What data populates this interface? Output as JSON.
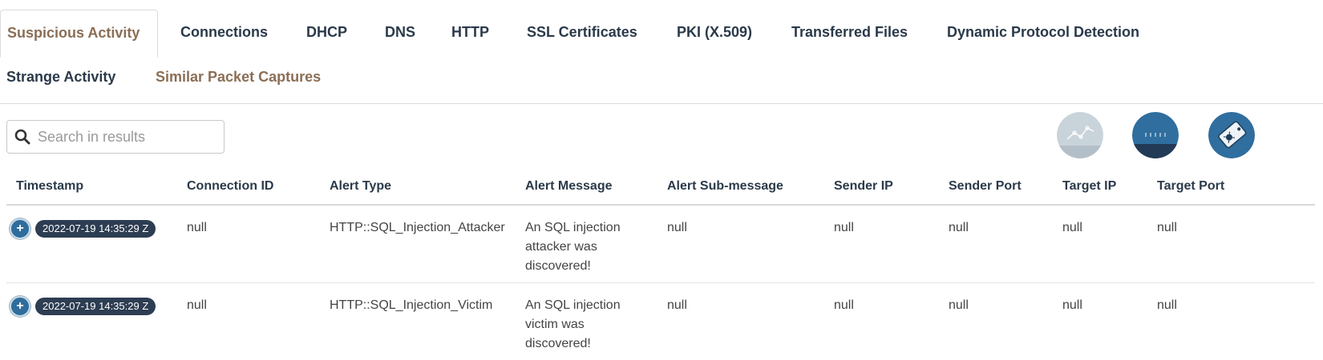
{
  "tabs": [
    {
      "label": "Suspicious Activity"
    },
    {
      "label": "Connections"
    },
    {
      "label": "DHCP"
    },
    {
      "label": "DNS"
    },
    {
      "label": "HTTP"
    },
    {
      "label": "SSL Certificates"
    },
    {
      "label": "PKI (X.509)"
    },
    {
      "label": "Transferred Files"
    },
    {
      "label": "Dynamic Protocol Detection"
    },
    {
      "label": "Strange Activity"
    },
    {
      "label": "Similar Packet Captures"
    }
  ],
  "search": {
    "placeholder": "Search in results",
    "value": ""
  },
  "table": {
    "headers": [
      "Timestamp",
      "Connection ID",
      "Alert Type",
      "Alert Message",
      "Alert Sub-message",
      "Sender IP",
      "Sender Port",
      "Target IP",
      "Target Port"
    ],
    "rows": [
      {
        "expand": "+",
        "timestamp": "2022-07-19 14:35:29 Z",
        "connection_id": "null",
        "alert_type": "HTTP::SQL_Injection_Attacker",
        "alert_message": "An SQL injection attacker was discovered!",
        "alert_submessage": "null",
        "sender_ip": "null",
        "sender_port": "null",
        "target_ip": "null",
        "target_port": "null"
      },
      {
        "expand": "+",
        "timestamp": "2022-07-19 14:35:29 Z",
        "connection_id": "null",
        "alert_type": "HTTP::SQL_Injection_Victim",
        "alert_message": "An SQL injection victim was discovered!",
        "alert_submessage": "null",
        "sender_ip": "null",
        "sender_port": "null",
        "target_ip": "null",
        "target_port": "null"
      }
    ]
  },
  "icons": {
    "search": "search-icon",
    "btn1": "line-graph-icon",
    "btn2": "packet-bar-icon",
    "btn3": "malware-tag-icon"
  },
  "colors": {
    "active_tab": "#8a6e55",
    "tab_text": "#2b3a4a",
    "badge_bg": "#2d3d52",
    "expand_btn": "#2e6d9c"
  }
}
